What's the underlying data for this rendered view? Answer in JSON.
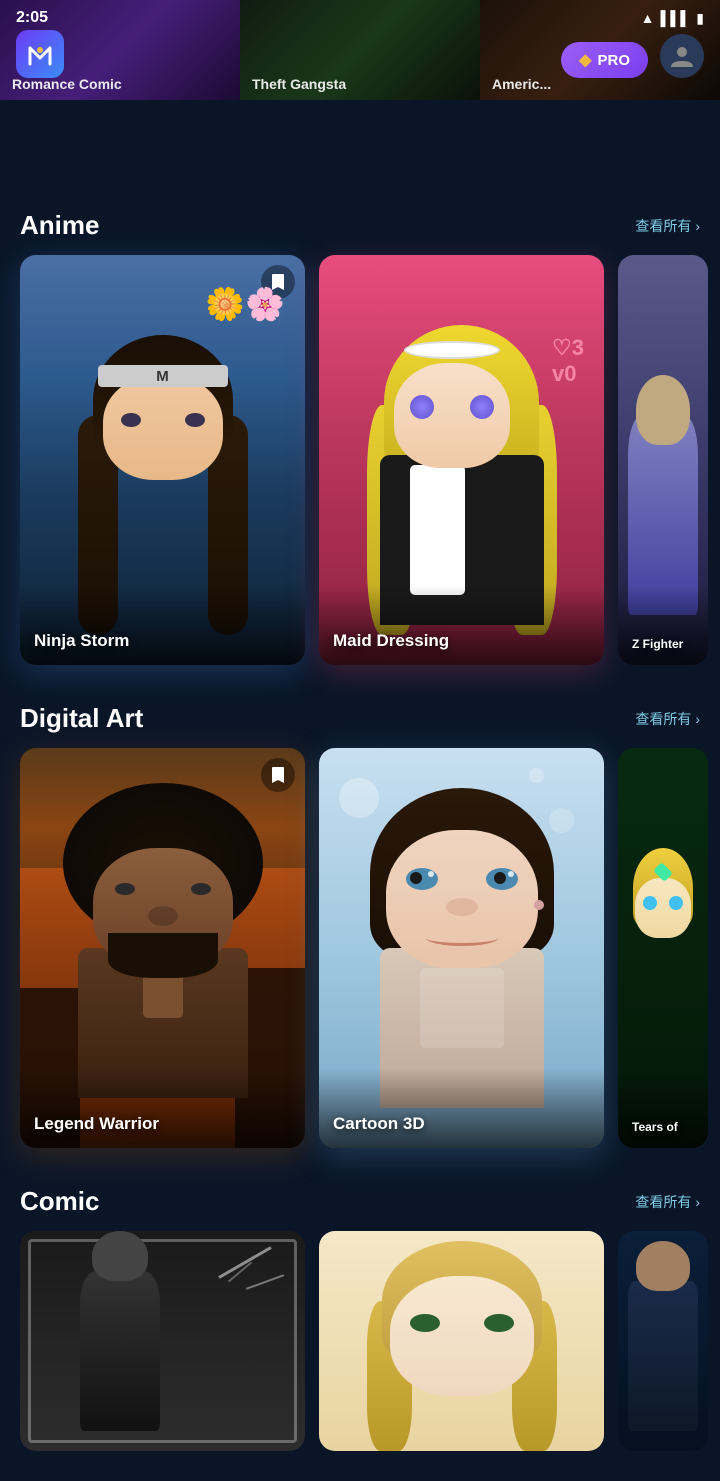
{
  "statusBar": {
    "time": "2:05",
    "icons": [
      "wifi",
      "signal",
      "battery"
    ]
  },
  "header": {
    "logoText": "M",
    "proBadgeLabel": "PRO",
    "proIcon": "◆"
  },
  "banners": [
    {
      "label": "Romance Comic"
    },
    {
      "label": "Theft Gangsta"
    },
    {
      "label": "Americ..."
    }
  ],
  "sections": {
    "anime": {
      "title": "Anime",
      "viewAllLabel": "查看所有",
      "cards": [
        {
          "label": "Ninja Storm",
          "hasBookmark": true
        },
        {
          "label": "Maid Dressing",
          "hasBookmark": false
        },
        {
          "label": "Z Fighter",
          "hasBookmark": false,
          "partial": true
        }
      ]
    },
    "digitalArt": {
      "title": "Digital Art",
      "viewAllLabel": "查看所有",
      "cards": [
        {
          "label": "Legend Warrior",
          "hasBookmark": true
        },
        {
          "label": "Cartoon 3D",
          "hasBookmark": false
        },
        {
          "label": "Tears of",
          "hasBookmark": false,
          "partial": true
        }
      ]
    },
    "comic": {
      "title": "Comic",
      "viewAllLabel": "查看所有",
      "cards": [
        {
          "label": "",
          "hasBookmark": false
        },
        {
          "label": "",
          "hasBookmark": false
        },
        {
          "label": "",
          "hasBookmark": false,
          "partial": true
        }
      ]
    }
  }
}
